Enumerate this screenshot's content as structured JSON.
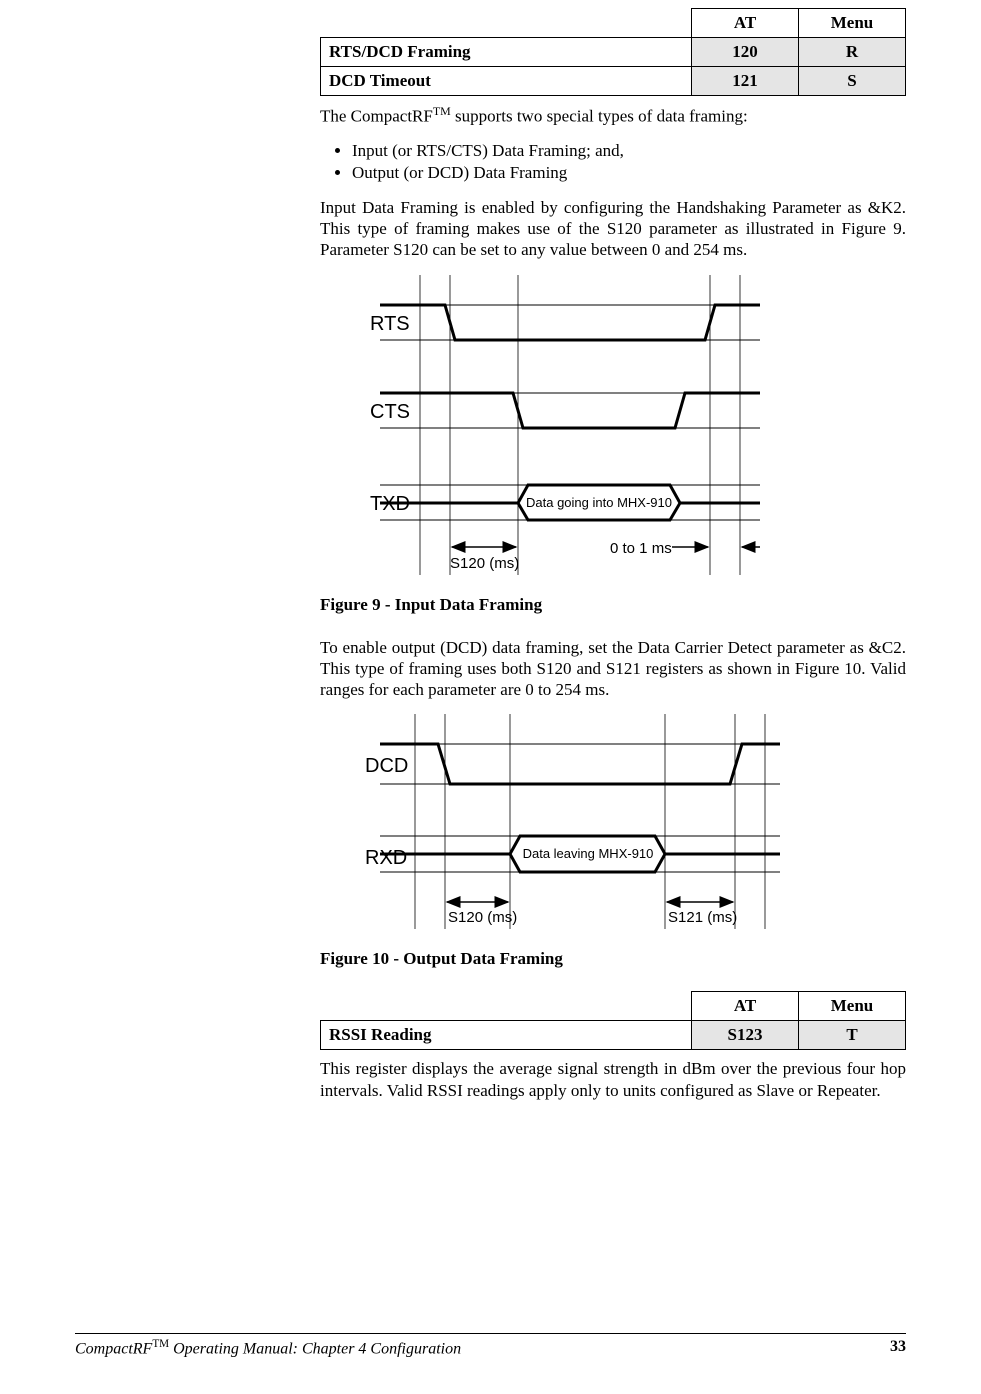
{
  "table1": {
    "head_at": "AT",
    "head_menu": "Menu",
    "rows": [
      {
        "label": "RTS/DCD Framing",
        "at": "120",
        "menu": "R"
      },
      {
        "label": "DCD Timeout",
        "at": "121",
        "menu": "S"
      }
    ]
  },
  "intro": {
    "p1a": "The CompactRF",
    "p1tm": "TM",
    "p1b": " supports two special types of data framing:",
    "bullets": [
      "Input (or RTS/CTS) Data Framing; and,",
      "Output (or DCD) Data Framing"
    ],
    "p2": "Input Data Framing is enabled by configuring the Handshaking Parameter as &K2.  This type of framing makes use of the S120 parameter as illustrated in Figure 9.  Parameter S120 can be set to any value between 0 and 254 ms."
  },
  "fig9": {
    "caption": "Figure 9 - Input Data Framing",
    "labels": {
      "rts": "RTS",
      "cts": "CTS",
      "txd": "TXD",
      "data": "Data going into MHX-910",
      "s120": "S120 (ms)",
      "t01": "0 to 1 ms"
    }
  },
  "mid_para": "To enable output (DCD) data framing, set the Data Carrier Detect parameter as &C2.  This type of framing uses both S120 and S121 registers as shown in Figure 10.  Valid ranges for each parameter are 0 to 254 ms.",
  "fig10": {
    "caption": "Figure 10 - Output Data Framing",
    "labels": {
      "dcd": "DCD",
      "rxd": "RXD",
      "data": "Data leaving MHX-910",
      "s120": "S120 (ms)",
      "s121": "S121 (ms)"
    }
  },
  "table2": {
    "head_at": "AT",
    "head_menu": "Menu",
    "row": {
      "label": "RSSI Reading",
      "at": "S123",
      "menu": "T"
    }
  },
  "rssi_para": "This register displays the average signal strength in dBm over the previous four hop intervals.  Valid RSSI readings apply only to units configured as Slave or Repeater.",
  "footer": {
    "left_a": "CompactRF",
    "left_tm": "TM",
    "left_b": " Operating Manual: Chapter 4 Configuration",
    "page": "33"
  },
  "chart_data": [
    {
      "type": "timing-diagram",
      "title": "Figure 9 - Input Data Framing",
      "signals": [
        "RTS",
        "CTS",
        "TXD"
      ],
      "annotations": [
        "Data going into MHX-910",
        "S120 (ms)",
        "0 to 1 ms"
      ],
      "parameters": {
        "S120_range_ms": [
          0,
          254
        ]
      }
    },
    {
      "type": "timing-diagram",
      "title": "Figure 10 - Output Data Framing",
      "signals": [
        "DCD",
        "RXD"
      ],
      "annotations": [
        "Data leaving MHX-910",
        "S120 (ms)",
        "S121 (ms)"
      ],
      "parameters": {
        "S120_range_ms": [
          0,
          254
        ],
        "S121_range_ms": [
          0,
          254
        ]
      }
    }
  ]
}
